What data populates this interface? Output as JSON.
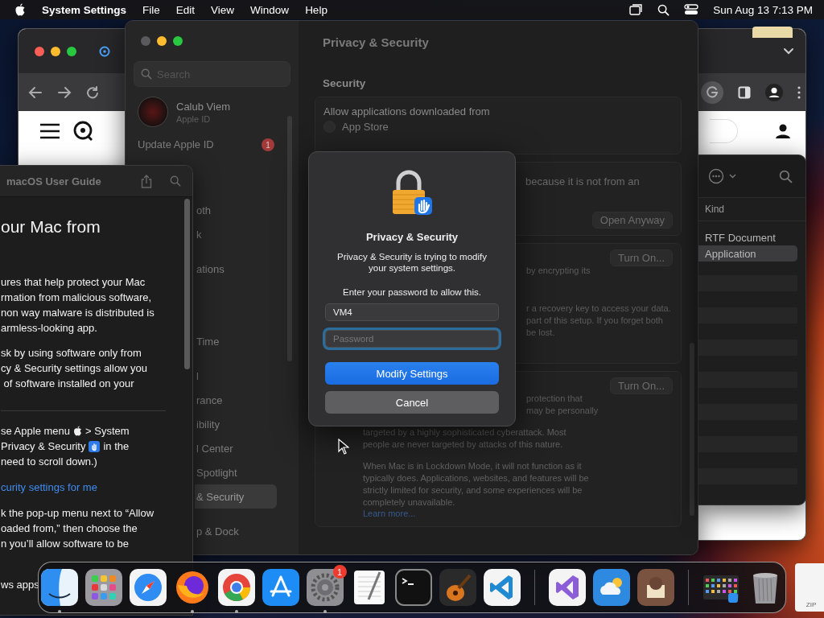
{
  "menu_bar": {
    "app_name": "System Settings",
    "menus": [
      "File",
      "Edit",
      "View",
      "Window",
      "Help"
    ],
    "clock": "Sun Aug 13  7:13 PM"
  },
  "help_window": {
    "title": "macOS User Guide",
    "heading": "our Mac from",
    "paragraphs": [
      "ures that help protect your Mac\nrmation from malicious software,\nnon way malware is distributed is\narmless-looking app.",
      "sk by using software only from\ncy & Security settings allow you\n of software installed on your"
    ],
    "step_lines": [
      [
        {
          "kind": "text",
          "text": "se Apple menu"
        },
        {
          "kind": "apple"
        },
        {
          "kind": "text",
          "text": "> System"
        }
      ],
      [
        {
          "kind": "text",
          "text": "Privacy & Security"
        },
        {
          "kind": "shield"
        },
        {
          "kind": "text",
          "text": "in the"
        }
      ],
      [
        {
          "kind": "text",
          "text": "need to scroll down.)"
        }
      ]
    ],
    "link": "curity settings for me",
    "paragraph_after": "k the pop-up menu next to “Allow\noaded from,” then choose the\nn you’ll allow software to be",
    "last_line": "ws apps"
  },
  "settings": {
    "window_title": "Privacy & Security",
    "search_placeholder": "Search",
    "account": {
      "name": "Calub Viem",
      "subtitle": "Apple ID"
    },
    "update_item": {
      "label": "Update Apple ID",
      "badge": "1"
    },
    "sidebar_items": [
      {
        "label": "oth",
        "selected": false
      },
      {
        "label": "k",
        "selected": false
      },
      {
        "label": "ations",
        "selected": false
      },
      {
        "label": "Time",
        "selected": false
      },
      {
        "label": "l",
        "selected": false
      },
      {
        "label": "rance",
        "selected": false
      },
      {
        "label": "ibility",
        "selected": false
      },
      {
        "label": "l Center",
        "selected": false
      },
      {
        "label": "Spotlight",
        "selected": false
      },
      {
        "label": "& Security",
        "selected": true
      },
      {
        "label": "p & Dock",
        "selected": false
      }
    ],
    "section_title": "Security",
    "cards": [
      {
        "kind": "radio",
        "title": "Allow applications downloaded from",
        "options": [
          {
            "label": "App Store",
            "selected": false
          }
        ]
      },
      {
        "kind": "bottom_button",
        "button": "Open Anyway",
        "blocks": [
          {
            "kind": "aside",
            "text": "because it is not from an"
          }
        ]
      },
      {
        "kind": "top_button",
        "button": "Turn On...",
        "blocks": [
          {
            "kind": "aside",
            "text": "by encrypting its"
          },
          {
            "kind": "aside",
            "text": "r a recovery key to access your data.\npart of this setup. If you forget both\nbe lost."
          }
        ]
      },
      {
        "kind": "top_button",
        "button": "Turn On...",
        "blocks": [
          {
            "kind": "aside",
            "text": "protection that\nmay be personally"
          },
          {
            "kind": "body",
            "text": "targeted by a highly sophisticated cyberattack. Most\npeople are never targeted by attacks of this nature."
          },
          {
            "kind": "body",
            "text": "When Mac is in Lockdown Mode, it will not function as it\ntypically does. Applications, websites, and features will be\nstrictly limited for security, and some experiences will be\ncompletely unavailable."
          },
          {
            "kind": "link",
            "text": "Learn more..."
          }
        ]
      }
    ]
  },
  "dialog": {
    "title": "Privacy & Security",
    "message": "Privacy & Security is trying to modify\nyour system settings.",
    "prompt": "Enter your password to allow this.",
    "username": "VM4",
    "password_placeholder": "Password",
    "password_focused": true,
    "buttons": [
      {
        "label": "Modify Settings",
        "primary": true
      },
      {
        "label": "Cancel",
        "primary": false
      }
    ]
  },
  "finder_window": {
    "column": "Kind",
    "rows": [
      {
        "label": "RTF Document",
        "selected": false
      },
      {
        "label": "Application",
        "selected": true
      }
    ]
  },
  "dock": {
    "groups": [
      [
        {
          "kind": "finder",
          "running": true
        },
        {
          "kind": "launchpad",
          "running": false
        },
        {
          "kind": "safari",
          "running": false
        },
        {
          "kind": "firefox",
          "running": true
        },
        {
          "kind": "chrome",
          "running": true
        },
        {
          "kind": "appstore",
          "running": false
        },
        {
          "kind": "settings",
          "running": true,
          "badge": "1"
        },
        {
          "kind": "textedit",
          "running": false
        },
        {
          "kind": "terminal",
          "running": false
        },
        {
          "kind": "garageband",
          "running": false
        },
        {
          "kind": "vscode",
          "running": false
        }
      ],
      [
        {
          "kind": "visualstudio",
          "running": false
        },
        {
          "kind": "weather",
          "running": false
        },
        {
          "kind": "app",
          "running": false
        }
      ],
      [
        {
          "kind": "stack",
          "running": false
        },
        {
          "kind": "trash",
          "running": false
        }
      ]
    ],
    "file_label": "ZIP"
  }
}
